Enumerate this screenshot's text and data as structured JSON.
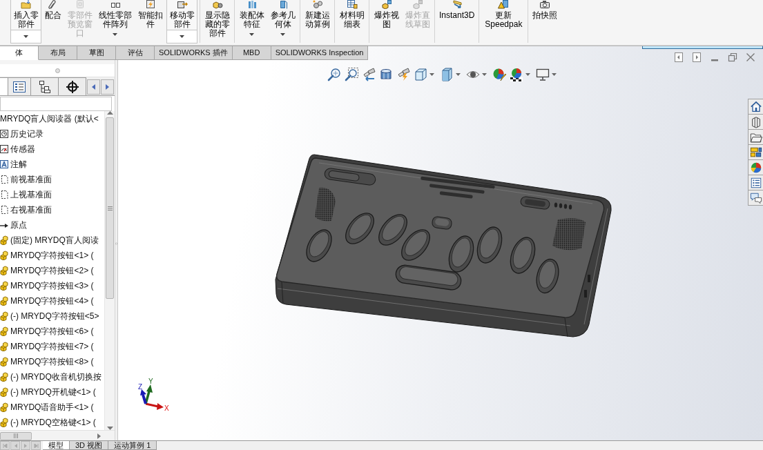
{
  "command_manager": {
    "groups": [
      {
        "items": [
          {
            "kind": "split",
            "label": "插入零部件",
            "disabled": false
          },
          {
            "kind": "button",
            "label": "配合",
            "disabled": false
          },
          {
            "kind": "button",
            "label": "零部件预览窗口",
            "disabled": true
          },
          {
            "kind": "menu",
            "label": "线性零部件阵列",
            "disabled": false
          },
          {
            "kind": "button",
            "label": "智能扣件",
            "disabled": false
          },
          {
            "kind": "split",
            "label": "移动零部件",
            "disabled": false
          }
        ]
      },
      {
        "items": [
          {
            "kind": "button",
            "label": "显示隐藏的零部件",
            "disabled": false
          }
        ]
      },
      {
        "items": [
          {
            "kind": "menu",
            "label": "装配体特征",
            "disabled": false
          },
          {
            "kind": "menu",
            "label": "参考几何体",
            "disabled": false
          }
        ]
      },
      {
        "items": [
          {
            "kind": "button",
            "label": "新建运动算例",
            "disabled": false
          }
        ]
      },
      {
        "items": [
          {
            "kind": "button",
            "label": "材料明细表",
            "disabled": false
          }
        ]
      },
      {
        "items": [
          {
            "kind": "button",
            "label": "爆炸视图",
            "disabled": false
          },
          {
            "kind": "button",
            "label": "爆炸直线草图",
            "disabled": true
          }
        ]
      },
      {
        "items": [
          {
            "kind": "button",
            "label": "Instant3D",
            "disabled": false
          }
        ]
      },
      {
        "items": [
          {
            "kind": "button",
            "label": "更新 Speedpak",
            "disabled": false
          }
        ]
      },
      {
        "items": [
          {
            "kind": "button",
            "label": "拍快照",
            "disabled": false
          }
        ]
      }
    ]
  },
  "command_tabs": [
    {
      "label": "体",
      "selected": true
    },
    {
      "label": "布局",
      "selected": false
    },
    {
      "label": "草图",
      "selected": false
    },
    {
      "label": "评估",
      "selected": false
    },
    {
      "label": "SOLIDWORKS 插件",
      "selected": false
    },
    {
      "label": "MBD",
      "selected": false
    },
    {
      "label": "SOLIDWORKS Inspection",
      "selected": false
    }
  ],
  "feature_manager": {
    "panel_tabs": [
      {
        "selected": true
      },
      {
        "selected": false
      },
      {
        "selected": false
      },
      {
        "selected": false
      }
    ],
    "tree": [
      {
        "label": "MRYDQ盲人阅读器 (默认<",
        "children": [
          {
            "kind": "history",
            "label": "历史记录"
          },
          {
            "kind": "sensor",
            "label": "传感器"
          },
          {
            "kind": "annotation",
            "label": "注解"
          },
          {
            "kind": "plane",
            "label": "前视基准面"
          },
          {
            "kind": "plane",
            "label": "上视基准面"
          },
          {
            "kind": "plane",
            "label": "右视基准面"
          },
          {
            "kind": "origin",
            "label": "原点"
          },
          {
            "kind": "part",
            "label": "(固定) MRYDQ盲人阅读"
          },
          {
            "kind": "part",
            "label": "MRYDQ字符按钮<1> ("
          },
          {
            "kind": "part",
            "label": "MRYDQ字符按钮<2> ("
          },
          {
            "kind": "part",
            "label": "MRYDQ字符按钮<3> ("
          },
          {
            "kind": "part",
            "label": "MRYDQ字符按钮<4> ("
          },
          {
            "kind": "part",
            "label": "(-) MRYDQ字符按钮<5>"
          },
          {
            "kind": "part",
            "label": "MRYDQ字符按钮<6> ("
          },
          {
            "kind": "part",
            "label": "MRYDQ字符按钮<7> ("
          },
          {
            "kind": "part",
            "label": "MRYDQ字符按钮<8> ("
          },
          {
            "kind": "part",
            "label": "(-) MRYDQ收音机切换按"
          },
          {
            "kind": "part",
            "label": "(-) MRYDQ开机键<1> ("
          },
          {
            "kind": "part",
            "label": "MRYDQ语音助手<1> ("
          },
          {
            "kind": "part",
            "label": "(-) MRYDQ空格键<1> ("
          }
        ]
      }
    ]
  },
  "bottom_tabs": [
    {
      "label": "模型",
      "selected": true
    },
    {
      "label": "3D 视图",
      "selected": false
    },
    {
      "label": "运动算例 1",
      "selected": false
    }
  ],
  "viewport": {
    "triad": {
      "x": "X",
      "y": "Y",
      "z": "Z"
    }
  }
}
